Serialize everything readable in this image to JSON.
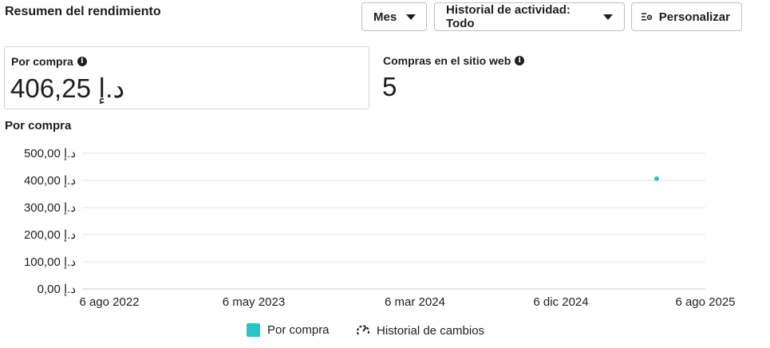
{
  "header": {
    "title": "Resumen del rendimiento"
  },
  "controls": {
    "period_label": "Mes",
    "history_label": "Historial de actividad: Todo",
    "customize_label": "Personalizar"
  },
  "metrics": [
    {
      "label": "Por compra",
      "value": "406,25 د.إ"
    },
    {
      "label": "Compras en el sitio web",
      "value": "5"
    }
  ],
  "chart_title": "Por compra",
  "chart_data": {
    "type": "scatter",
    "title": "Por compra",
    "x_ticks": [
      "6 ago 2022",
      "6 may 2023",
      "6 mar 2024",
      "6 dic 2024",
      "6 ago 2025"
    ],
    "x_range": [
      "2022-08-06",
      "2025-08-06"
    ],
    "y_ticks": [
      "0,00 د.إ",
      "100,00 د.إ",
      "200,00 د.إ",
      "300,00 د.إ",
      "400,00 د.إ",
      "500,00 د.إ"
    ],
    "ylim": [
      0,
      500
    ],
    "grid": true,
    "series": [
      {
        "name": "Por compra",
        "color": "#2bc4c6",
        "points": [
          {
            "x": "2025-05-06",
            "y": 406.25
          }
        ]
      }
    ],
    "legend": [
      "Por compra",
      "Historial de cambios"
    ],
    "legend_position": "bottom"
  }
}
